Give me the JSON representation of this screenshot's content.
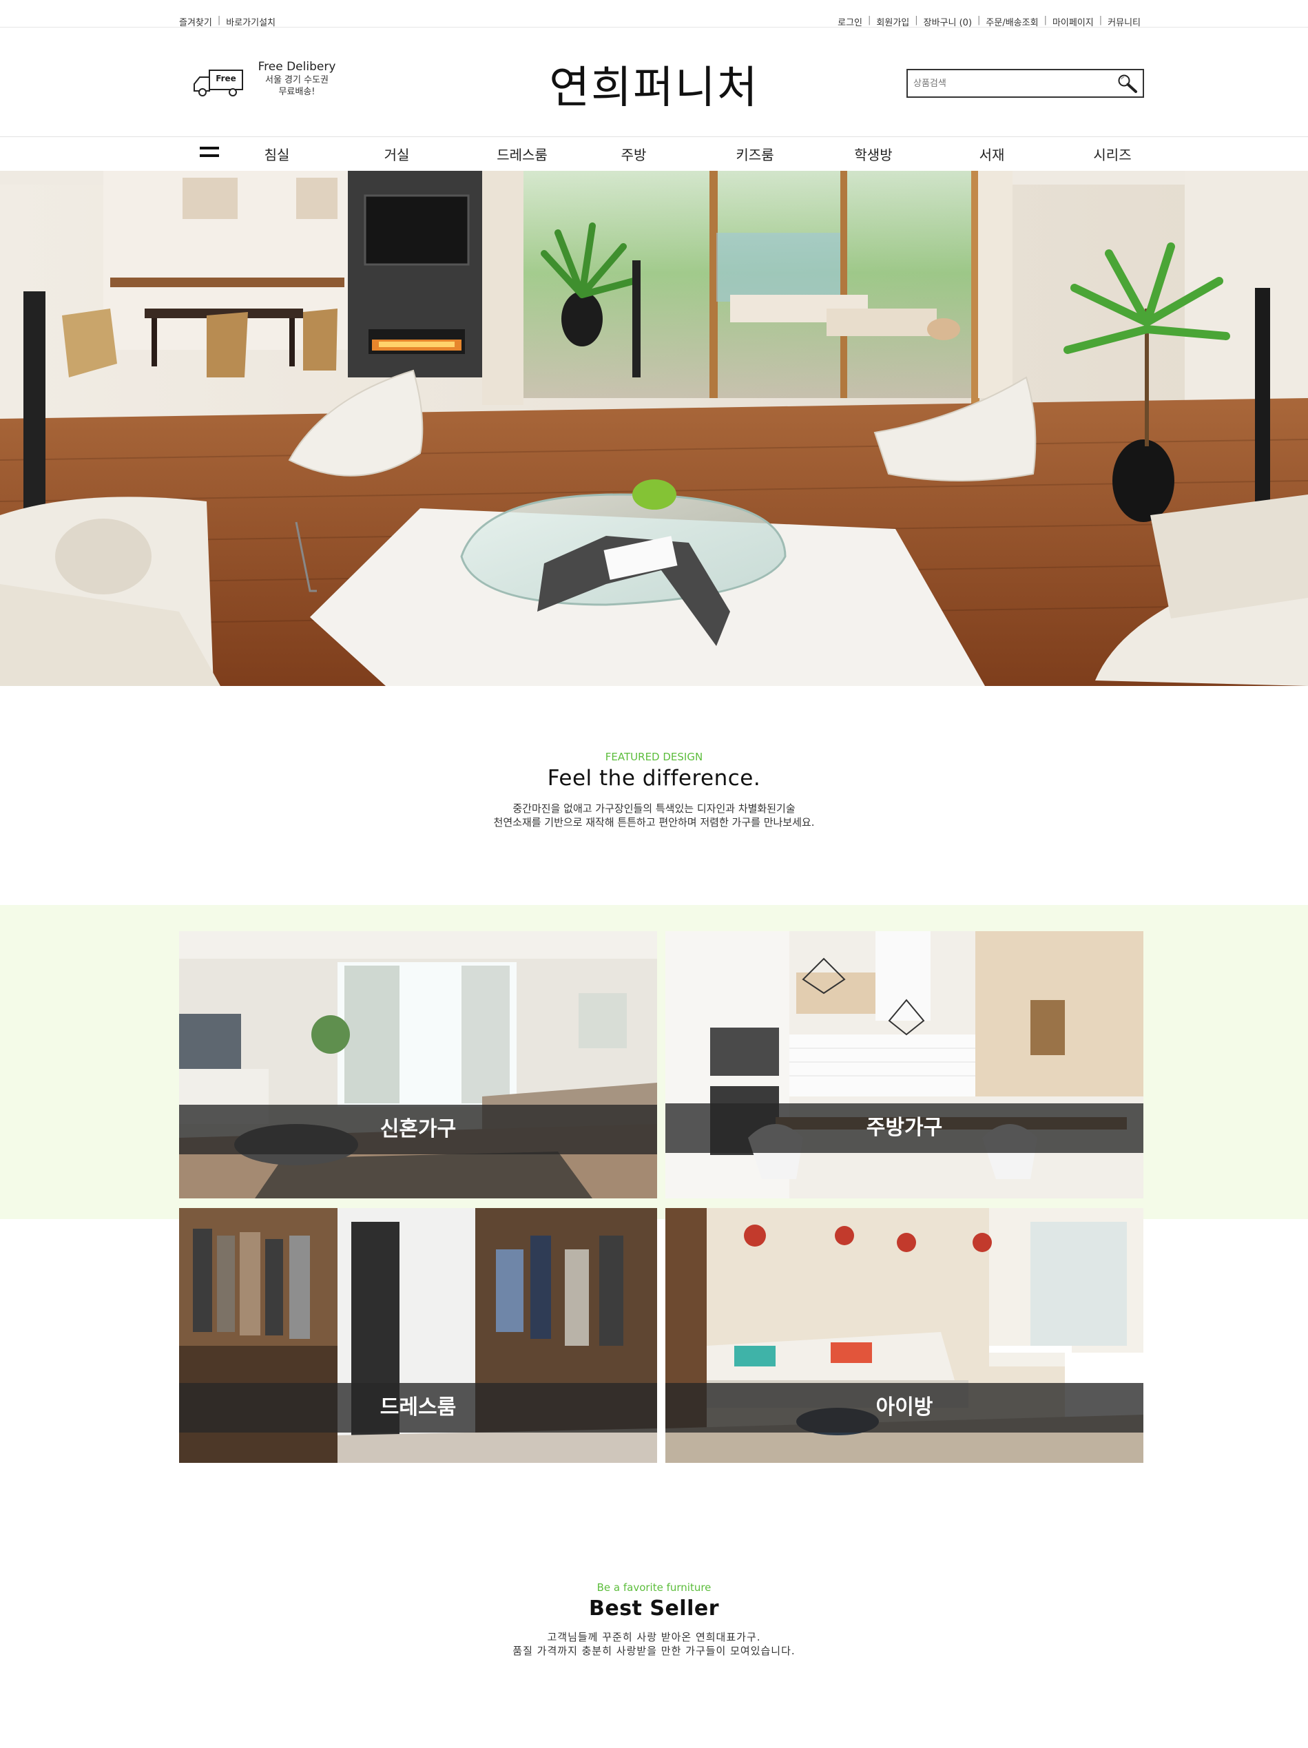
{
  "util": {
    "left": [
      "즐겨찾기",
      "바로가기설치"
    ],
    "right": [
      "로그인",
      "회원가입",
      "장바구니 (0)",
      "주문/배송조회",
      "마이페이지",
      "커뮤니티"
    ]
  },
  "header": {
    "delivery_badge": "Free",
    "delivery_title": "Free Delibery",
    "delivery_sub1": "서울 경기 수도권",
    "delivery_sub2": "무료배송!",
    "logo": "연희퍼니처",
    "search_placeholder": "상품검색"
  },
  "nav": {
    "items": [
      "침실",
      "거실",
      "드레스룸",
      "주방",
      "키즈룸",
      "학생방",
      "서재",
      "시리즈"
    ]
  },
  "featured": {
    "eyebrow": "FEATURED DESIGN",
    "title": "Feel the difference.",
    "desc1": "중간마진을 없애고 가구장인들의 특색있는 디자인과 차별화된기술",
    "desc2": "천연소재를 기반으로 재작해 튼튼하고 편안하며 저렴한 가구를 만나보세요."
  },
  "categories": [
    {
      "label": "신혼가구"
    },
    {
      "label": "주방가구"
    },
    {
      "label": "드레스룸"
    },
    {
      "label": "아이방"
    }
  ],
  "best": {
    "eyebrow": "Be a favorite furniture",
    "title": "Best Seller",
    "desc1": "고객님들께 꾸준히 사랑 받아온 연희대표가구.",
    "desc2": "품질 가격까지 충분히 사랑받을 만한 가구들이 모여있습니다."
  },
  "colors": {
    "accent_green": "#5cbd3c",
    "category_bg": "#f4fbe8",
    "label_band": "#282828"
  }
}
